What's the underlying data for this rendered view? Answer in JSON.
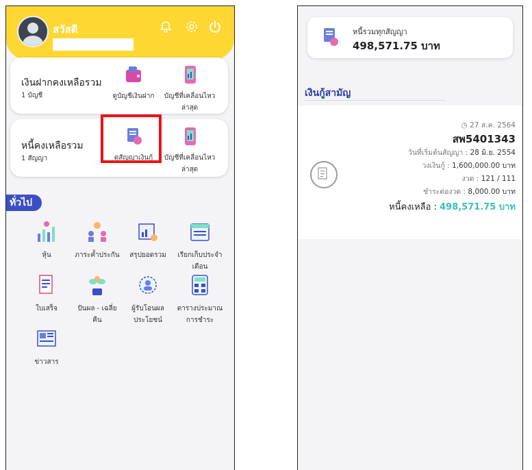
{
  "left": {
    "greeting": "สวัสดี",
    "icons": {
      "bell": "bell-icon",
      "gear": "gear-icon",
      "power": "power-icon"
    },
    "deposit_card": {
      "title": "เงินฝากคงเหลือรวม",
      "sub": "1 บัญชี",
      "action1": "ดูบัญชีเงินฝาก",
      "action2_l1": "บัญชีที่เคลื่อนไหว",
      "action2_l2": "ล่าสุด"
    },
    "debt_card": {
      "title": "หนี้คงเหลือรวม",
      "sub": "1 สัญญา",
      "action1": "ดูสัญญาเงินกู้",
      "action2_l1": "บัญชีที่เคลื่อนไหว",
      "action2_l2": "ล่าสุด"
    },
    "section": "ทั่วไป",
    "menu": [
      {
        "l1": "หุ้น",
        "l2": ""
      },
      {
        "l1": "ภาระค้ำประกัน",
        "l2": ""
      },
      {
        "l1": "สรุปยอดรวม",
        "l2": ""
      },
      {
        "l1": "เรียกเก็บประจำ",
        "l2": "เดือน"
      },
      {
        "l1": "ใบเสร็จ",
        "l2": ""
      },
      {
        "l1": "ปันผล - เฉลี่ย",
        "l2": "คืน"
      },
      {
        "l1": "ผู้รับโอนผล",
        "l2": "ประโยชน์"
      },
      {
        "l1": "ตารางประมาณ",
        "l2": "การชำระ"
      },
      {
        "l1": "ข่าวสาร",
        "l2": ""
      }
    ],
    "highlight_color": "#e8141a",
    "header_color": "#ffd733"
  },
  "right": {
    "total_label": "หนี้รวมทุกสัญญา",
    "total_amount": "498,571.75 บาท",
    "section": "เงินกู้สามัญ",
    "date": "27 ส.ค. 2564",
    "contract_no": "สพ5401343",
    "start_label": "วันที่เริ่มต้นสัญญา : ",
    "start_value": "28 มิ.ย. 2554",
    "limit_label": "วงเงินกู้ : ",
    "limit_value": "1,600,000.00 บาท",
    "period_label": "งวด : ",
    "period_value": "121 / 111",
    "installment_label": "ชำระต่องวด : ",
    "installment_value": "8,000.00 บาท",
    "balance_label": "หนี้คงเหลือ : ",
    "balance_value": "498,571.75 บาท",
    "accent_color": "#38c0b4"
  }
}
